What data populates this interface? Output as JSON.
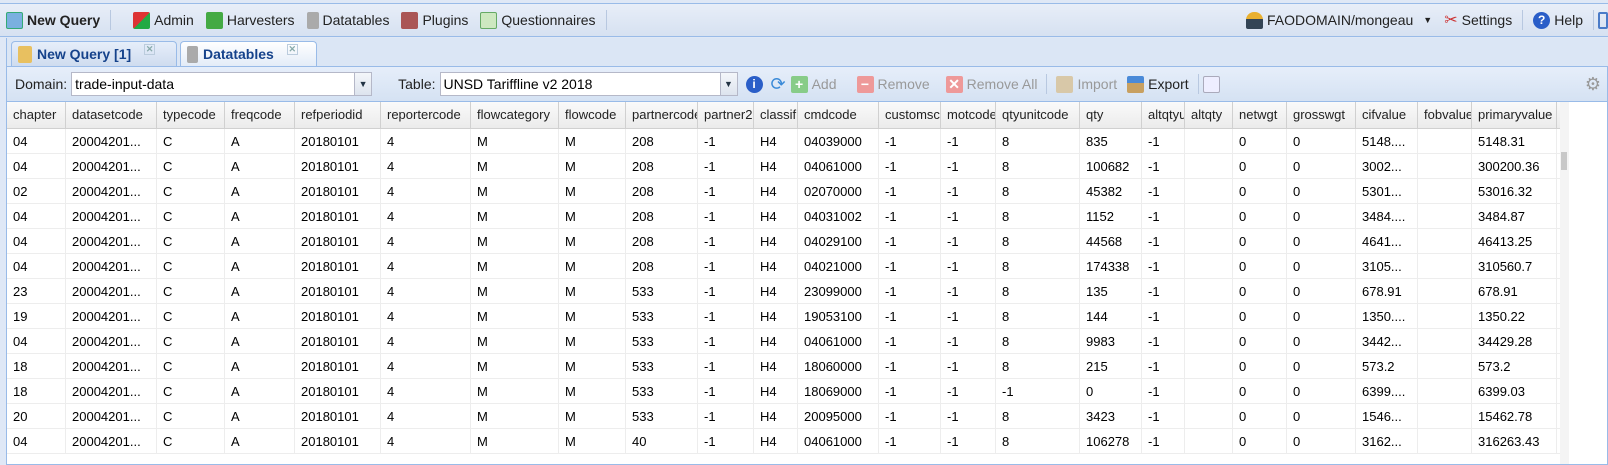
{
  "toolbar": {
    "new_query": "New Query",
    "admin": "Admin",
    "harvesters": "Harvesters",
    "datatables": "Datatables",
    "plugins": "Plugins",
    "questionnaires": "Questionnaires",
    "user": "FAODOMAIN/mongeau",
    "settings": "Settings",
    "help": "Help"
  },
  "tabs": [
    {
      "label": "New Query [1]"
    },
    {
      "label": "Datatables"
    }
  ],
  "filters": {
    "domain_label": "Domain:",
    "domain_value": "trade-input-data",
    "table_label": "Table:",
    "table_value": "UNSD Tariffline v2 2018"
  },
  "actions": {
    "add": "Add",
    "remove": "Remove",
    "remove_all": "Remove All",
    "import": "Import",
    "export": "Export"
  },
  "grid": {
    "columns": [
      "chapter",
      "datasetcode",
      "typecode",
      "freqcode",
      "refperiodid",
      "reportercode",
      "flowcategory",
      "flowcode",
      "partnercode",
      "partner2",
      "classification",
      "cmdcode",
      "customscode",
      "motcode",
      "qtyunitcode",
      "qty",
      "altqtyunit",
      "altqty",
      "netwgt",
      "grosswgt",
      "cifvalue",
      "fobvalue",
      "primaryvalue"
    ],
    "rows": [
      [
        "04",
        "20004201...",
        "C",
        "A",
        "20180101",
        "4",
        "M",
        "M",
        "208",
        "-1",
        "H4",
        "04039000",
        "-1",
        "-1",
        "8",
        "835",
        "-1",
        "",
        "0",
        "0",
        "5148....",
        "",
        "5148.31"
      ],
      [
        "04",
        "20004201...",
        "C",
        "A",
        "20180101",
        "4",
        "M",
        "M",
        "208",
        "-1",
        "H4",
        "04061000",
        "-1",
        "-1",
        "8",
        "100682",
        "-1",
        "",
        "0",
        "0",
        "3002...",
        "",
        "300200.36"
      ],
      [
        "02",
        "20004201...",
        "C",
        "A",
        "20180101",
        "4",
        "M",
        "M",
        "208",
        "-1",
        "H4",
        "02070000",
        "-1",
        "-1",
        "8",
        "45382",
        "-1",
        "",
        "0",
        "0",
        "5301...",
        "",
        "53016.32"
      ],
      [
        "04",
        "20004201...",
        "C",
        "A",
        "20180101",
        "4",
        "M",
        "M",
        "208",
        "-1",
        "H4",
        "04031002",
        "-1",
        "-1",
        "8",
        "1152",
        "-1",
        "",
        "0",
        "0",
        "3484....",
        "",
        "3484.87"
      ],
      [
        "04",
        "20004201...",
        "C",
        "A",
        "20180101",
        "4",
        "M",
        "M",
        "208",
        "-1",
        "H4",
        "04029100",
        "-1",
        "-1",
        "8",
        "44568",
        "-1",
        "",
        "0",
        "0",
        "4641...",
        "",
        "46413.25"
      ],
      [
        "04",
        "20004201...",
        "C",
        "A",
        "20180101",
        "4",
        "M",
        "M",
        "208",
        "-1",
        "H4",
        "04021000",
        "-1",
        "-1",
        "8",
        "174338",
        "-1",
        "",
        "0",
        "0",
        "3105...",
        "",
        "310560.7"
      ],
      [
        "23",
        "20004201...",
        "C",
        "A",
        "20180101",
        "4",
        "M",
        "M",
        "533",
        "-1",
        "H4",
        "23099000",
        "-1",
        "-1",
        "8",
        "135",
        "-1",
        "",
        "0",
        "0",
        "678.91",
        "",
        "678.91"
      ],
      [
        "19",
        "20004201...",
        "C",
        "A",
        "20180101",
        "4",
        "M",
        "M",
        "533",
        "-1",
        "H4",
        "19053100",
        "-1",
        "-1",
        "8",
        "144",
        "-1",
        "",
        "0",
        "0",
        "1350....",
        "",
        "1350.22"
      ],
      [
        "04",
        "20004201...",
        "C",
        "A",
        "20180101",
        "4",
        "M",
        "M",
        "533",
        "-1",
        "H4",
        "04061000",
        "-1",
        "-1",
        "8",
        "9983",
        "-1",
        "",
        "0",
        "0",
        "3442...",
        "",
        "34429.28"
      ],
      [
        "18",
        "20004201...",
        "C",
        "A",
        "20180101",
        "4",
        "M",
        "M",
        "533",
        "-1",
        "H4",
        "18060000",
        "-1",
        "-1",
        "8",
        "215",
        "-1",
        "",
        "0",
        "0",
        "573.2",
        "",
        "573.2"
      ],
      [
        "18",
        "20004201...",
        "C",
        "A",
        "20180101",
        "4",
        "M",
        "M",
        "533",
        "-1",
        "H4",
        "18069000",
        "-1",
        "-1",
        "-1",
        "0",
        "-1",
        "",
        "0",
        "0",
        "6399....",
        "",
        "6399.03"
      ],
      [
        "20",
        "20004201...",
        "C",
        "A",
        "20180101",
        "4",
        "M",
        "M",
        "533",
        "-1",
        "H4",
        "20095000",
        "-1",
        "-1",
        "8",
        "3423",
        "-1",
        "",
        "0",
        "0",
        "1546...",
        "",
        "15462.78"
      ],
      [
        "04",
        "20004201...",
        "C",
        "A",
        "20180101",
        "4",
        "M",
        "M",
        "40",
        "-1",
        "H4",
        "04061000",
        "-1",
        "-1",
        "8",
        "106278",
        "-1",
        "",
        "0",
        "0",
        "3162...",
        "",
        "316263.43"
      ]
    ]
  }
}
